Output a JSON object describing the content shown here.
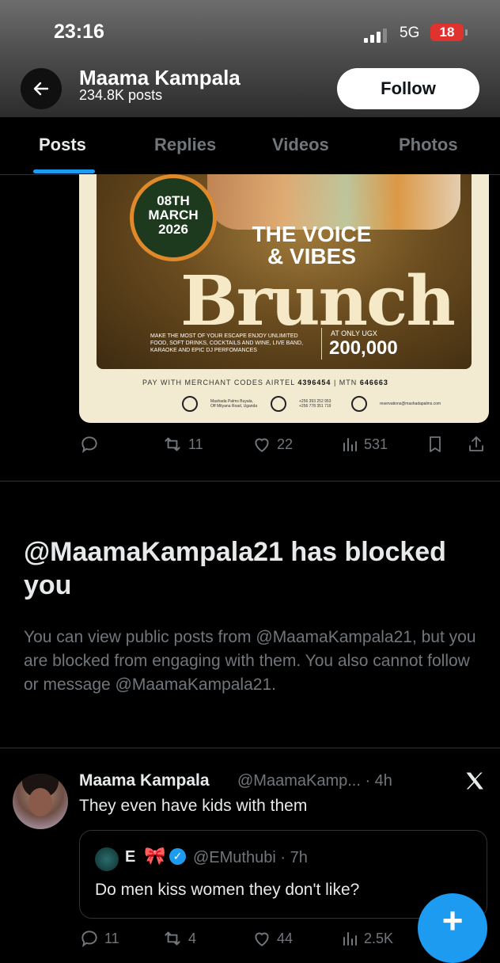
{
  "status_bar": {
    "time": "23:16",
    "network": "5G",
    "battery": "18"
  },
  "profile_header": {
    "name": "Maama Kampala",
    "posts": "234.8K posts",
    "follow_label": "Follow"
  },
  "tabs": [
    {
      "label": "Posts",
      "active": true
    },
    {
      "label": "Replies",
      "active": false
    },
    {
      "label": "Videos",
      "active": false
    },
    {
      "label": "Photos",
      "active": false
    }
  ],
  "flyer": {
    "date_line1": "08TH",
    "date_line2": "MARCH",
    "date_line3": "2026",
    "title_line1": "THE VOICE",
    "title_line2": "& VIBES",
    "title_big": "Brunch",
    "description": "MAKE THE MOST OF YOUR ESCAPE ENJOY UNLIMITED FOOD, SOFT DRINKS, COCKTAILS AND WINE, LIVE BAND, KARAOKE AND EPIC DJ PERFOMANCES",
    "price_prefix": "AT ONLY UGX",
    "price": "200,000",
    "pay_text": "PAY WITH MERCHANT CODES AIRTEL",
    "airtel_code": "4396454",
    "mtn_label": "| MTN",
    "mtn_code": "646663",
    "location": "Mashada Palms Buyala, Off Mityana Road, Uganda",
    "phone": "+256 393 252 953 +256 778 351 719",
    "email": "reservations@mashadapalms.com"
  },
  "post1_actions": {
    "retweets": "11",
    "likes": "22",
    "views": "531"
  },
  "blocked": {
    "title": "@MaamaKampala21 has blocked you",
    "description": "You can view public posts from @MaamaKampala21, but you are blocked from engaging with them. You also cannot follow or message @MaamaKampala21."
  },
  "tweet": {
    "name": "Maama Kampala",
    "handle_time": "@MaamaKamp... · 4h",
    "text": "They even have kids with them",
    "quote": {
      "name": "E",
      "bow": "🎀",
      "handle_time": "@EMuthubi · 7h",
      "text": "Do men kiss women they don't like?"
    },
    "actions": {
      "replies": "11",
      "retweets": "4",
      "likes": "44",
      "views": "2.5K"
    }
  },
  "icons": {
    "back": "arrow-left-icon",
    "x_logo": "x-logo-icon",
    "compose": "plus-icon"
  },
  "colors": {
    "accent": "#1d9bf0",
    "muted": "#71767b",
    "text": "#e7e9ea",
    "battery": "#e0332f"
  }
}
